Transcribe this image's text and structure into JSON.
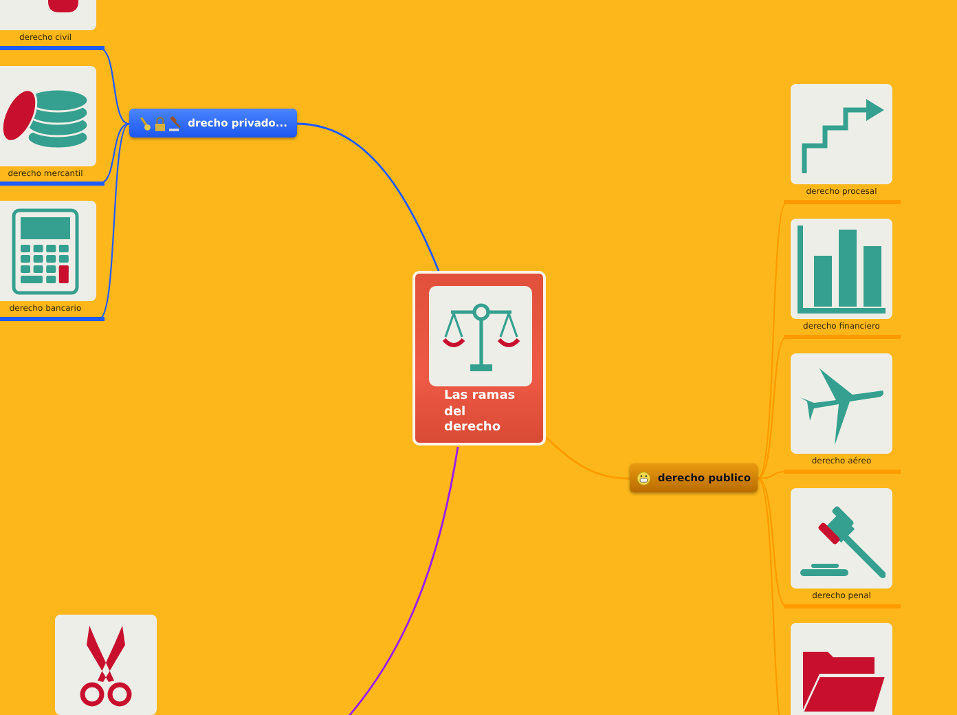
{
  "center": {
    "title": "Las ramas del derecho"
  },
  "branches": [
    {
      "kind": "topic",
      "label": "drecho privado...",
      "color": "#1f5cff",
      "children": [
        {
          "kind": "civil",
          "label": "derecho civil"
        },
        {
          "kind": "coins",
          "label": "derecho mercantil"
        },
        {
          "kind": "calculator",
          "label": "derecho bancario"
        }
      ]
    },
    {
      "kind": "topic",
      "label": "derecho publico",
      "color": "#ff9a00",
      "children": [
        {
          "kind": "stairs",
          "label": "derecho procesal"
        },
        {
          "kind": "bars",
          "label": "derecho financiero"
        },
        {
          "kind": "plane",
          "label": "derecho aéreo"
        },
        {
          "kind": "gavel",
          "label": "derecho penal"
        },
        {
          "kind": "folder"
        }
      ]
    },
    {
      "kind": "image",
      "color": "#9b1cf0"
    }
  ]
}
